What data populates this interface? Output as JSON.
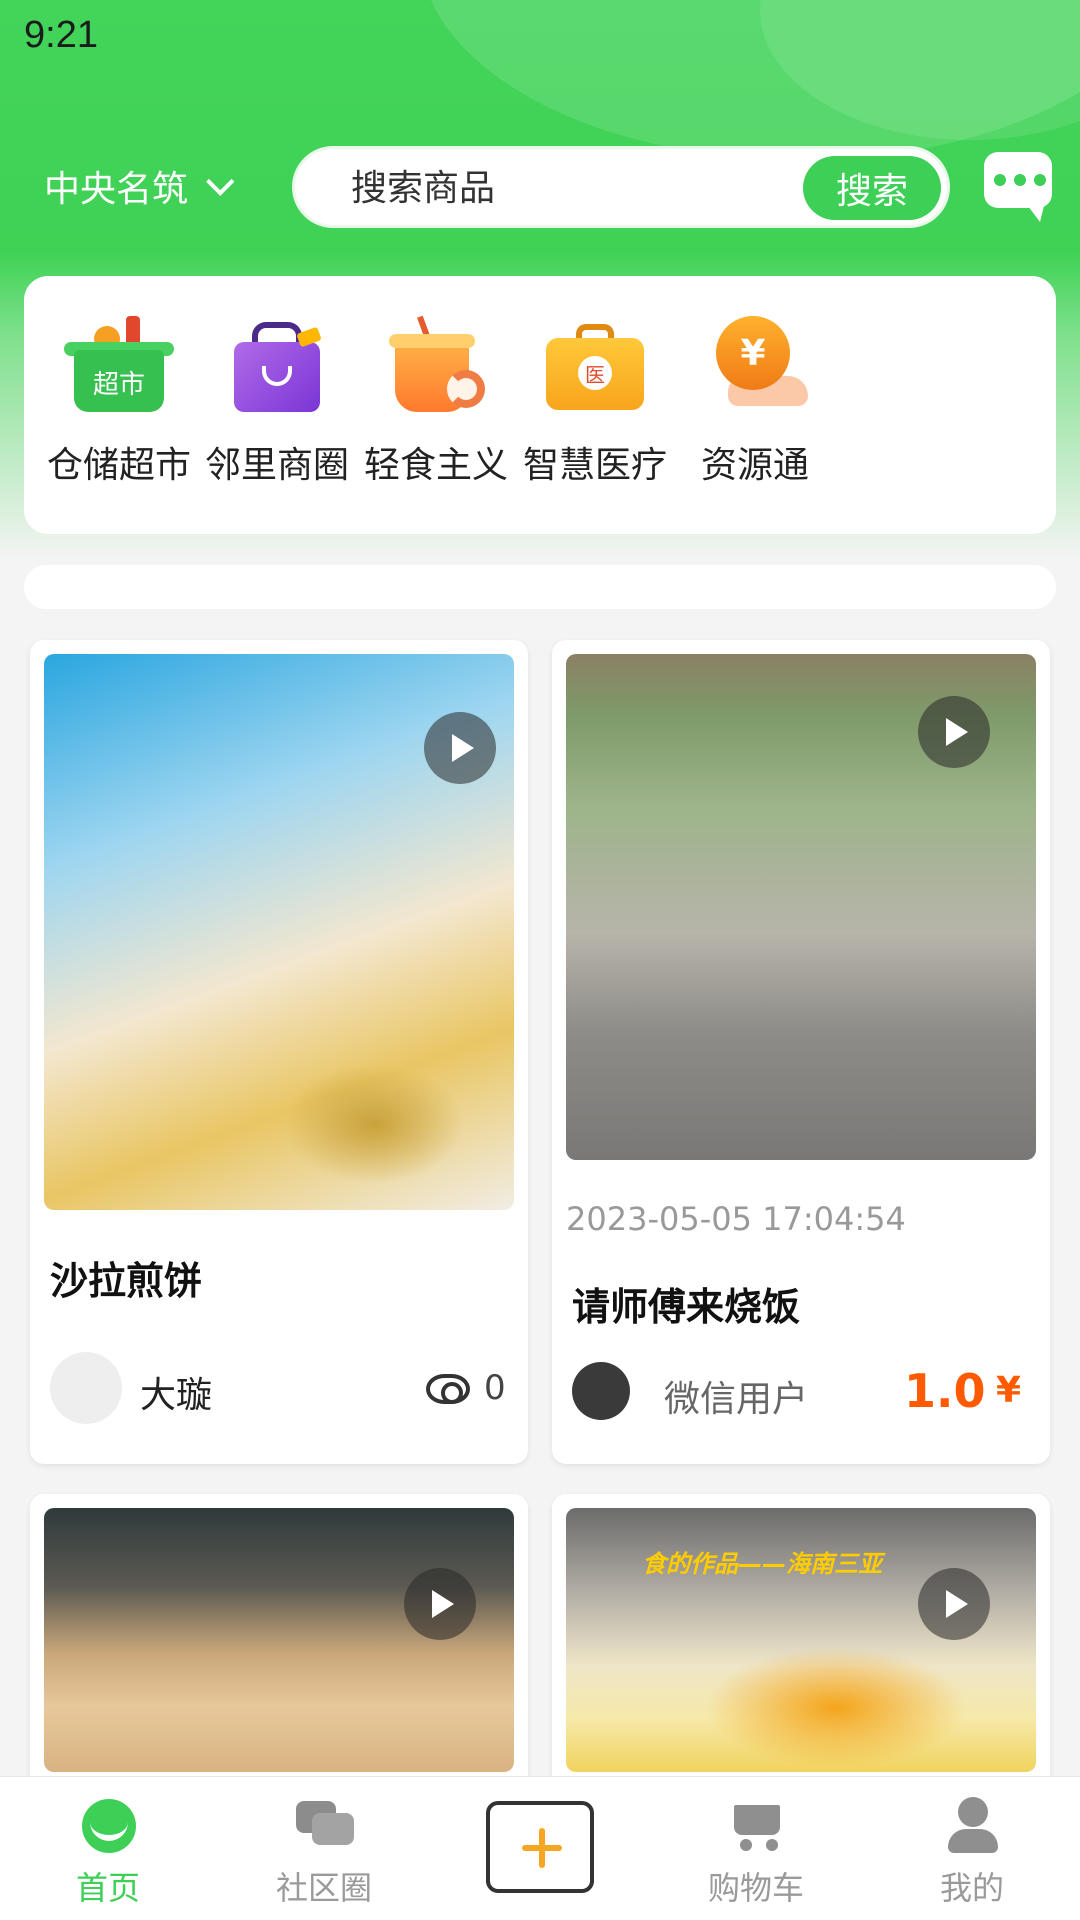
{
  "status": {
    "time": "9:21"
  },
  "header": {
    "location": "中央名筑",
    "search_placeholder": "搜索商品",
    "search_button": "搜索"
  },
  "categories": [
    {
      "label": "仓储超市",
      "icon": "supermarket-basket-icon",
      "badge": "超市"
    },
    {
      "label": "邻里商圈",
      "icon": "shopping-bag-icon"
    },
    {
      "label": "轻食主义",
      "icon": "drink-cup-icon"
    },
    {
      "label": "智慧医疗",
      "icon": "medical-kit-icon",
      "badge": "医"
    },
    {
      "label": "资源通",
      "icon": "coin-hand-icon",
      "badge": "¥"
    }
  ],
  "feed": [
    {
      "title": "沙拉煎饼",
      "author": "大璇",
      "views": "0"
    },
    {
      "date": "2023-05-05 17:04:54",
      "title": "请师傅来烧饭",
      "author": "微信用户",
      "price": "1.0",
      "currency": "¥"
    },
    {
      "title": ""
    },
    {
      "overlay_text": "食的作品——海南三亚"
    }
  ],
  "tabbar": [
    {
      "label": "首页",
      "active": true
    },
    {
      "label": "社区圈"
    },
    {
      "label": ""
    },
    {
      "label": "购物车"
    },
    {
      "label": "我的"
    }
  ],
  "colors": {
    "brand_green": "#3ecf56",
    "price_orange": "#ff5a00"
  }
}
